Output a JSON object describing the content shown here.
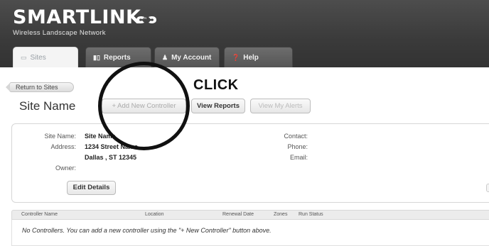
{
  "brand": {
    "name": "SMARTLINK",
    "trademark": "™",
    "tagline": "Wireless Landscape Network"
  },
  "tabs": [
    {
      "label": "Sites",
      "icon": "sites-icon"
    },
    {
      "label": "Reports",
      "icon": "reports-icon"
    },
    {
      "label": "My Account",
      "icon": "user-icon"
    },
    {
      "label": "Help",
      "icon": "help-icon"
    }
  ],
  "toolbar": {
    "return_label": "Return to Sites",
    "site_title": "Site Name",
    "click_annotation": "CLICK",
    "add_controller_label": "+ Add New Controller",
    "view_reports_label": "View Reports",
    "view_alerts_label": "View My Alerts"
  },
  "details": {
    "site_name_label": "Site Name:",
    "site_name_value": "Site Name",
    "address_label": "Address:",
    "address_line1": "1234 Street Name",
    "address_line2": "Dallas , ST 12345",
    "owner_label": "Owner:",
    "contact_label": "Contact:",
    "phone_label": "Phone:",
    "email_label": "Email:",
    "edit_label": "Edit Details"
  },
  "controllers_table": {
    "columns": [
      "Controller Name",
      "Location",
      "Renewal Date",
      "Zones",
      "Run Status"
    ],
    "empty_message": "No Controllers. You can add a new controller using the \"+ New Controller\" button above."
  },
  "colors": {
    "header_bg": "#3a3a3a",
    "annotation_circle": "#111111"
  }
}
